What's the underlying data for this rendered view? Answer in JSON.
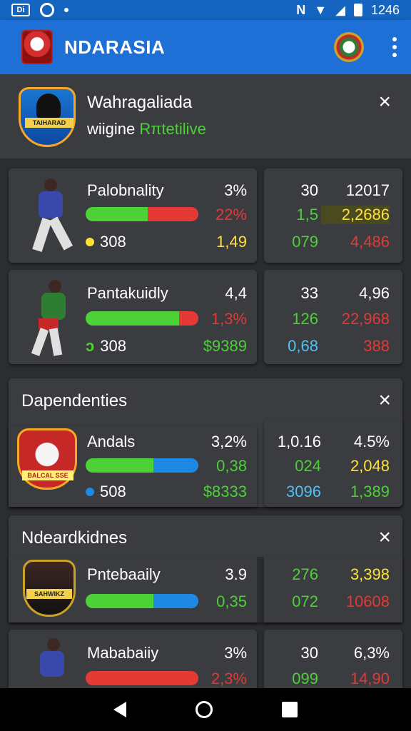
{
  "status": {
    "left_icon_text": "Di",
    "time": "1246"
  },
  "app": {
    "title": "NDARASIA"
  },
  "colors": {
    "appbar": "#1e6fd6",
    "green": "#4cd137",
    "red": "#e53935",
    "blue": "#1e88e5",
    "yellow": "#ffe135",
    "cyan": "#4fc3f7"
  },
  "header_card": {
    "team": "Wahragaliada",
    "sub_prefix": "wiigine ",
    "sub_accent": "Rπtetilive",
    "badge_text": "TAIHARAD",
    "close": "×"
  },
  "rows": [
    {
      "label": "Palobnality",
      "pct": "3%",
      "bar_pct": 0.55,
      "bar_a": "green",
      "bar_b": "red",
      "val2": "22%",
      "val2_color": "red",
      "dot_icon": "yellow-dot",
      "count": "308",
      "val3": "1,49",
      "val3_color": "yellow",
      "r1a": "30",
      "r1b": "12017",
      "r2a": "1,5",
      "r2b": "2,2686",
      "r3a": "079",
      "r3b": "4,486"
    },
    {
      "label": "Pantakuidly",
      "pct": "4,4",
      "bar_pct": 0.83,
      "bar_a": "green",
      "bar_b": "red",
      "val2": "1,3%",
      "val2_color": "red",
      "dot_icon": "green-leaf",
      "count": "308",
      "val3": "$9389",
      "val3_color": "green",
      "r1a": "33",
      "r1b": "4,96",
      "r2a": "126",
      "r2b": "22,968",
      "r3a": "0,68",
      "r3b": "388"
    }
  ],
  "section2": {
    "title": "Dapendenties",
    "close": "×",
    "badge_text": "BALCAL SSE",
    "label": "Andals",
    "pct": "3,2%",
    "val2": "0,38",
    "val3": "$8333",
    "count": "508",
    "dot_icon": "blue-dot",
    "bar_pct": 0.6,
    "r1a": "1,0.16",
    "r1b": "4.5%",
    "r2a": "024",
    "r2b": "2,048",
    "r3a": "3096",
    "r3b": "1,389"
  },
  "section3": {
    "title": "Ndeardkidnes",
    "close": "×",
    "badge_text": "SAHWIKZ",
    "label": "Pntebaaily",
    "pct": "3.9",
    "val2": "0,35",
    "bar_pct": 0.6,
    "r1a": "276",
    "r1b": "3,398",
    "r2a": "072",
    "r2b": "10608"
  },
  "row4": {
    "label": "Mababaiiy",
    "pct": "3%",
    "val2": "2,3%",
    "bar_pct": 1.0,
    "r1a": "30",
    "r1b": "6,3%",
    "r2a": "099",
    "r2b": "14,90"
  }
}
